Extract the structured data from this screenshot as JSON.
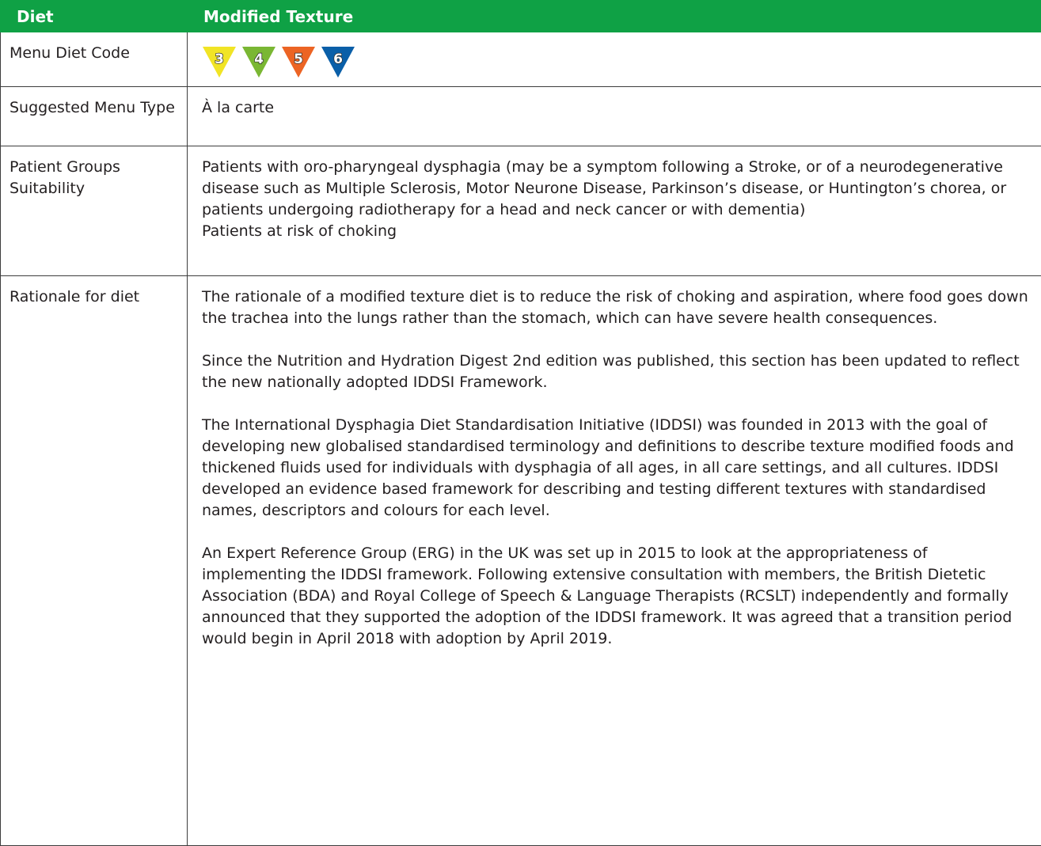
{
  "header": {
    "col1": "Diet",
    "col2": "Modified Texture"
  },
  "rows": {
    "menu_diet_code": {
      "label": "Menu Diet Code",
      "codes": [
        {
          "number": "3",
          "color": "#f1e425",
          "icon": "iddsi-level-3-triangle-icon"
        },
        {
          "number": "4",
          "color": "#7ab733",
          "icon": "iddsi-level-4-triangle-icon"
        },
        {
          "number": "5",
          "color": "#ec6424",
          "icon": "iddsi-level-5-triangle-icon"
        },
        {
          "number": "6",
          "color": "#0a5fa8",
          "icon": "iddsi-level-6-triangle-icon"
        }
      ]
    },
    "suggested_menu_type": {
      "label": "Suggested Menu Type",
      "value": "À la carte"
    },
    "patient_groups": {
      "label": "Patient Groups Suitability",
      "lines": [
        "Patients with oro-pharyngeal dysphagia (may be a symptom following a Stroke, or of a neurodegenerative disease such as Multiple Sclerosis, Motor Neurone Disease, Parkinson’s disease, or Huntington’s chorea, or patients undergoing radiotherapy for a head and neck cancer or with dementia)",
        "Patients at risk of choking"
      ]
    },
    "rationale": {
      "label": "Rationale for diet",
      "paragraphs": [
        "The rationale of a modified texture diet is to reduce the risk of choking and aspiration, where food goes down the trachea into the lungs rather than the stomach, which can have severe health consequences.",
        "Since the Nutrition and Hydration Digest 2nd edition was published, this section has been updated to reflect the new nationally adopted IDDSI Framework.",
        "The International Dysphagia Diet Standardisation Initiative (IDDSI) was founded in 2013 with the goal of developing new globalised standardised terminology and definitions to describe texture modified foods and thickened fluids used for individuals with dysphagia of all ages, in all care settings, and all cultures. IDDSI developed an evidence based framework for describing and testing different textures with standardised names, descriptors and colours for each level.",
        "An Expert Reference Group (ERG) in the UK was set up in 2015 to look at the appropriateness of implementing the IDDSI framework. Following extensive consultation with members, the British Dietetic Association (BDA) and Royal College of Speech & Language Therapists (RCSLT) independently and formally announced that they supported the adoption of the IDDSI framework. It was agreed that a transition period would begin in April 2018 with adoption by April 2019."
      ]
    }
  }
}
